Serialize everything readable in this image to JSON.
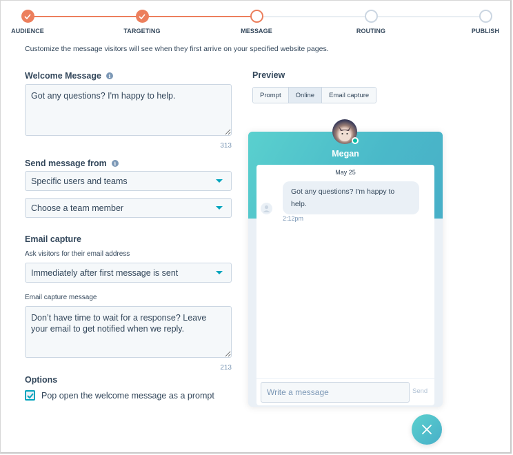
{
  "stepper": {
    "steps": [
      {
        "label": "AUDIENCE",
        "state": "done"
      },
      {
        "label": "TARGETING",
        "state": "done"
      },
      {
        "label": "MESSAGE",
        "state": "current"
      },
      {
        "label": "ROUTING",
        "state": "todo"
      },
      {
        "label": "PUBLISH",
        "state": "todo"
      }
    ]
  },
  "intro": "Customize the message visitors will see when they first arrive on your specified website pages.",
  "welcome": {
    "label": "Welcome Message",
    "value": "Got any questions? I'm happy to help.",
    "remaining": "313"
  },
  "send_from": {
    "label": "Send message from",
    "mode": "Specific users and teams",
    "member": "Choose a team member"
  },
  "email_capture": {
    "label": "Email capture",
    "ask_label": "Ask visitors for their email address",
    "timing": "Immediately after first message is sent",
    "message_label": "Email capture message",
    "message_value": "Don’t have time to wait for a response? Leave your email to get notified when we reply.",
    "remaining": "213"
  },
  "options": {
    "label": "Options",
    "popopen_label": "Pop open the welcome message as a prompt",
    "popopen_checked": true
  },
  "preview": {
    "label": "Preview",
    "tabs": [
      {
        "label": "Prompt",
        "active": false
      },
      {
        "label": "Online",
        "active": true
      },
      {
        "label": "Email capture",
        "active": false
      }
    ],
    "agent_name": "Megan",
    "agent_status": "online",
    "date": "May 25",
    "message": "Got any questions? I'm happy to help.",
    "time": "2:12pm",
    "compose_placeholder": "Write a message",
    "send_label": "Send"
  },
  "colors": {
    "accent_orange": "#ec7f5d",
    "accent_teal": "#00a4bd",
    "widget_gradient_start": "#5ad0ce",
    "widget_gradient_end": "#48afc8",
    "online_green": "#00bda5"
  }
}
